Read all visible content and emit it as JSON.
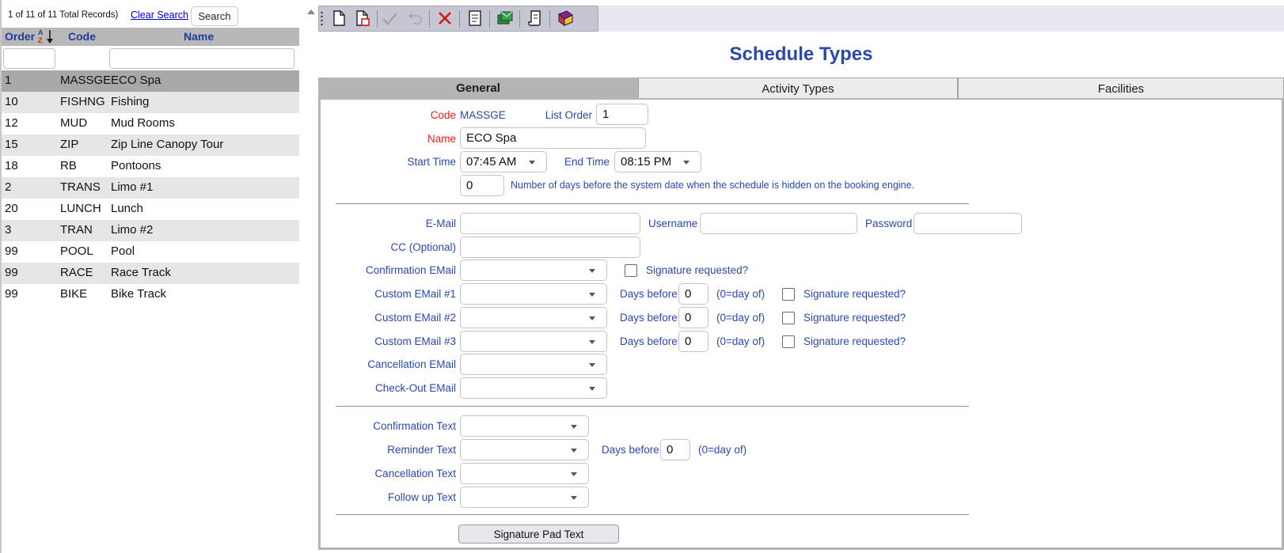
{
  "list": {
    "record_count": "1 of 11 of 11 Total Records)",
    "clear_search": "Clear Search",
    "search_button": "Search",
    "columns": {
      "order": "Order",
      "code": "Code",
      "name": "Name"
    },
    "rows": [
      {
        "order": "1",
        "code": "MASSGE",
        "name": "ECO Spa",
        "selected": true
      },
      {
        "order": "10",
        "code": "FISHNG",
        "name": "Fishing"
      },
      {
        "order": "12",
        "code": "MUD",
        "name": "Mud Rooms"
      },
      {
        "order": "15",
        "code": "ZIP",
        "name": "Zip Line Canopy Tour"
      },
      {
        "order": "18",
        "code": "RB",
        "name": "Pontoons"
      },
      {
        "order": "2",
        "code": "TRANS",
        "name": "Limo #1"
      },
      {
        "order": "20",
        "code": "LUNCH",
        "name": "Lunch"
      },
      {
        "order": "3",
        "code": "TRAN",
        "name": "Limo #2"
      },
      {
        "order": "99",
        "code": "POOL",
        "name": "Pool"
      },
      {
        "order": "99",
        "code": "RACE",
        "name": "Race Track"
      },
      {
        "order": "99",
        "code": "BIKE",
        "name": "Bike Track"
      }
    ]
  },
  "toolbar": {
    "icons": [
      "new-record-icon",
      "copy-record-icon",
      "save-icon",
      "undo-icon",
      "delete-icon",
      "report-icon",
      "email-icon",
      "script-icon",
      "help-book-icon"
    ]
  },
  "page_title": "Schedule Types",
  "tabs": [
    {
      "label": "General",
      "active": true
    },
    {
      "label": "Activity Types"
    },
    {
      "label": "Facilities"
    }
  ],
  "form": {
    "code_label": "Code",
    "code_value": "MASSGE",
    "list_order_label": "List Order",
    "list_order_value": "1",
    "name_label": "Name",
    "name_value": "ECO Spa",
    "start_time_label": "Start Time",
    "start_time_value": "07:45 AM",
    "end_time_label": "End Time",
    "end_time_value": "08:15 PM",
    "days_hidden_value": "0",
    "days_hidden_text": "Number of days before the system date when the schedule is hidden on the booking engine.",
    "email_label": "E-Mail",
    "username_label": "Username",
    "password_label": "Password",
    "cc_label": "CC (Optional)",
    "confirmation_email_label": "Confirmation EMail",
    "signature_requested": "Signature requested?",
    "custom_email_1_label": "Custom EMail #1",
    "custom_email_2_label": "Custom EMail #2",
    "custom_email_3_label": "Custom EMail #3",
    "days_before_label": "Days before",
    "day_of_hint": "(0=day of)",
    "custom_days_1": "0",
    "custom_days_2": "0",
    "custom_days_3": "0",
    "cancellation_email_label": "Cancellation EMail",
    "checkout_email_label": "Check-Out EMail",
    "confirmation_text_label": "Confirmation Text",
    "reminder_text_label": "Reminder Text",
    "reminder_days": "0",
    "cancellation_text_label": "Cancellation Text",
    "follow_up_text_label": "Follow up Text",
    "signature_pad_button": "Signature Pad Text"
  },
  "colors": {
    "label_blue": "#2b49a8",
    "required_red": "#e0201c",
    "title_blue": "#2c48a8",
    "selected_row": "#a8a8a8",
    "alt_row": "#e6e6e6"
  }
}
